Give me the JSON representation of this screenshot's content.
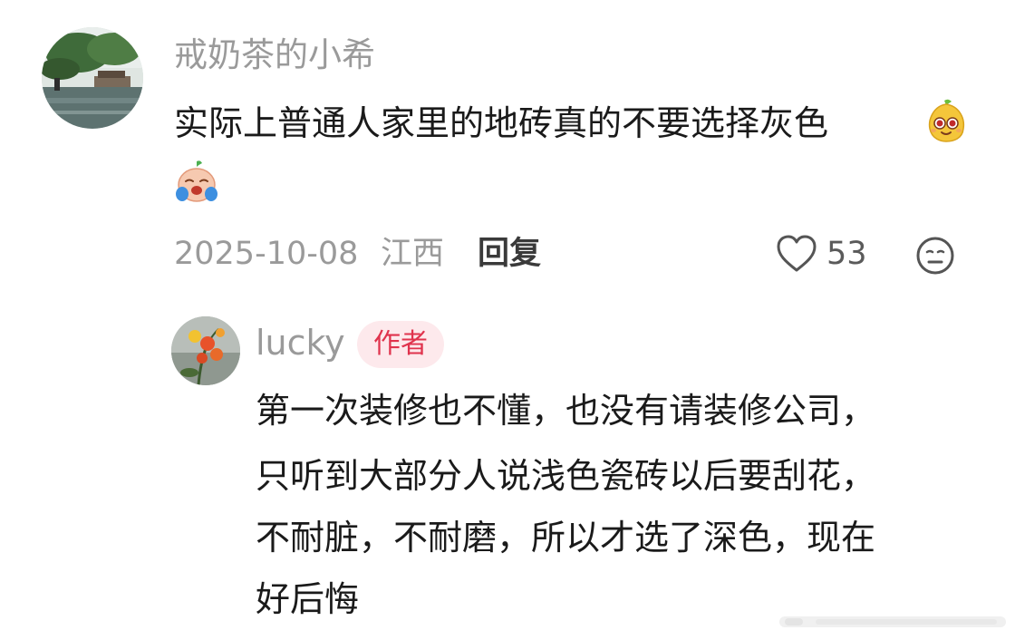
{
  "comment": {
    "username": "戒奶茶的小希",
    "text": "实际上普通人家里的地砖真的不要选择灰色",
    "emojis": [
      "pear-smile-emoji",
      "crying-face-emoji"
    ],
    "date": "2025-10-08",
    "region": "江西",
    "reply_label": "回复",
    "likes": "53",
    "icons": {
      "like": "heart-icon",
      "dislike": "neutral-face-icon"
    }
  },
  "reply": {
    "username": "lucky",
    "badge": "作者",
    "lines": [
      "第一次装修也不懂，也没有请装修公司，",
      "只听到大部分人说浅色瓷砖以后要刮花，",
      "不耐脏，不耐磨，所以才选了深色，现在",
      "好后悔"
    ]
  },
  "colors": {
    "muted_text": "#9a9a9a",
    "body_text": "#1a1a1a",
    "badge_bg": "#fde9ec",
    "badge_text": "#e0334d"
  }
}
